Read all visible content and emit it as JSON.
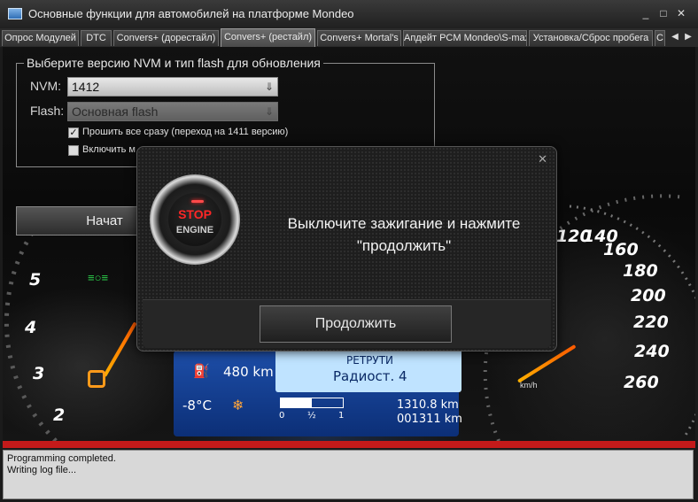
{
  "window": {
    "title": "Основные функции для автомобилей на платформе Mondeo"
  },
  "tabs": [
    {
      "label": "Опрос Модулей"
    },
    {
      "label": "DTC"
    },
    {
      "label": "Convers+ (дорестайл)"
    },
    {
      "label": "Convers+ (рестайл)",
      "active": true
    },
    {
      "label": "Convers+ Mortal's"
    },
    {
      "label": "Апдейт PCM Mondeo\\S-max"
    },
    {
      "label": "Установка/Сброс пробега"
    },
    {
      "label": "С"
    }
  ],
  "nvm_group": {
    "legend": "Выберите версию NVM и тип flash для обновления",
    "nvm_label": "NVM:",
    "nvm_value": "1412",
    "flash_label": "Flash:",
    "flash_value": "Основная flash",
    "flash_all_label": "Прошить все сразу (переход на 1411 версию)",
    "flash_all_checked": true,
    "include_label": "Включить м",
    "include_checked": false
  },
  "start_button": {
    "label": "Начат"
  },
  "dashboard": {
    "left_gauge": [
      "5",
      "4",
      "3",
      "2"
    ],
    "right_gauge": [
      "120",
      "140",
      "160",
      "180",
      "200",
      "220",
      "240",
      "260"
    ],
    "lcd_range": "480 km",
    "lcd_temp": "-8°C",
    "lcd_menu_top": "РЕТРУТИ",
    "lcd_menu": "Радиост. 4",
    "lcd_odometer": "1310.8 km",
    "lcd_trip": "001311 km",
    "lcd_fuel_scale": [
      "0",
      "½",
      "1"
    ],
    "speed_unit": "km/h"
  },
  "dialog": {
    "message": "Выключите зажигание и нажмите \"продолжить\"",
    "stop_text": "STOP",
    "engine_text": "ENGINE",
    "continue_label": "Продолжить"
  },
  "progress": {
    "value": 1.0
  },
  "log": {
    "lines": [
      "Programming completed.",
      "Writing log file..."
    ]
  },
  "colors": {
    "progress": "#c41a1a",
    "stop_red": "#ff2626",
    "needle": "#ff7a00",
    "lcd_blue": "#1d4ea8"
  }
}
